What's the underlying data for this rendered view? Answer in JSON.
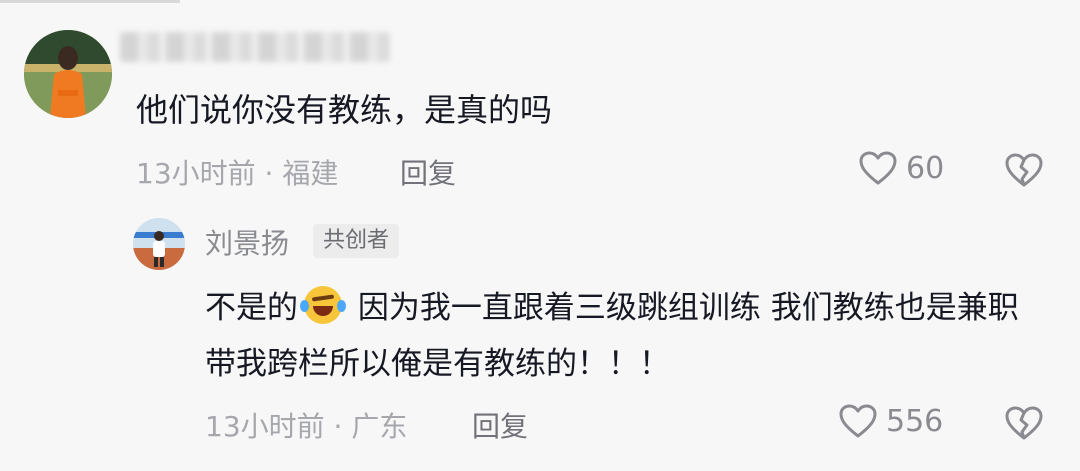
{
  "comments": [
    {
      "text": "他们说你没有教练，是真的吗",
      "meta": "13小时前 · 福建",
      "reply_label": "回复",
      "like_count": "60"
    },
    {
      "username": "刘景扬",
      "badge": "共创者",
      "text_before_emoji": "不是的",
      "text_after_emoji": " 因为我一直跟着三级跳组训练 我们教练也是兼职带我跨栏所以俺是有教练的！！！",
      "meta": "13小时前 · 广东",
      "reply_label": "回复",
      "like_count": "556"
    }
  ],
  "icons": {
    "like": "heart-outline-icon",
    "dislike": "broken-heart-icon",
    "emoji": "tears-of-joy-emoji"
  },
  "colors": {
    "background": "#f7f7f7",
    "text": "#161823",
    "meta": "#a6a7ad",
    "icon": "#8a8b91"
  }
}
